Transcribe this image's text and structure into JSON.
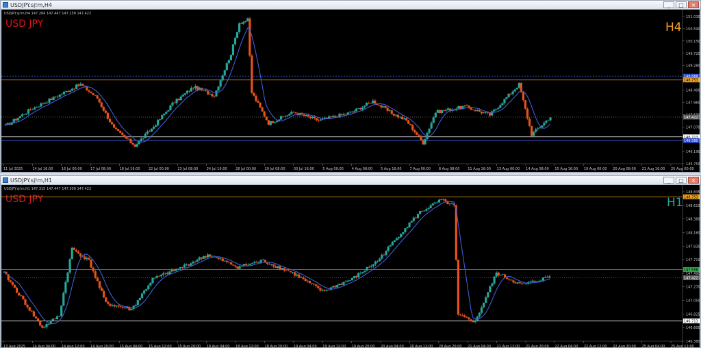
{
  "window1": {
    "title": "USDJPY.sj!m,H4",
    "info": "USDJPY.sj!m,H4  147.284 147.447 147.258 147.422",
    "symbol_label": "USD JPY",
    "timeframe_label": "H4",
    "price_axis": [
      "151.030",
      "150.590",
      "150.150",
      "149.720",
      "149.280",
      "148.840",
      "148.400",
      "147.960",
      "147.530",
      "147.070",
      "146.630",
      "146.190",
      "145.750"
    ],
    "tags": {
      "blue_top": "148.888",
      "orange": "148.753",
      "current": "147.422",
      "white": "146.713",
      "blue_bottom": "146.580"
    },
    "time_axis": [
      "11 Jul 2025",
      "14 Jul 16:00",
      "16 Jul 00:00",
      "17 Jul 08:00",
      "18 Jul 16:00",
      "22 Jul 00:00",
      "23 Jul 08:00",
      "24 Jul 16:00",
      "28 Jul 00:00",
      "29 Jul 08:00",
      "30 Jul 16:00",
      "5 Aug 00:00",
      "4 Aug 08:00",
      "5 Aug 16:00",
      "7 Aug 00:00",
      "8 Aug 08:00",
      "11 Aug 16:00",
      "13 Aug 00:00",
      "14 Aug 08:00",
      "15 Aug 16:00",
      "19 Aug 00:00",
      "20 Aug 08:00",
      "21 Aug 16:00",
      "25 Aug 00:00"
    ]
  },
  "window2": {
    "title": "USDJPY.sj!m,H1",
    "info": "USDJPY.sj!m,H1  147.315 147.447 147.309 147.422",
    "symbol_label": "USD JPY",
    "timeframe_label": "H1",
    "price_axis": [
      "148.835",
      "148.610",
      "148.380",
      "148.160",
      "147.935",
      "147.710",
      "147.490",
      "147.270",
      "147.050",
      "146.825",
      "146.600",
      "146.380"
    ],
    "tags": {
      "orange": "148.753",
      "green": "147.556",
      "current": "147.422",
      "white": "146.713"
    },
    "time_axis": [
      "13 Aug 2025",
      "14 Aug 04:00",
      "14 Aug 12:00",
      "14 Aug 20:00",
      "15 Aug 04:00",
      "15 Aug 12:00",
      "15 Aug 20:00",
      "18 Aug 04:00",
      "18 Aug 12:00",
      "18 Aug 20:00",
      "19 Aug 04:00",
      "19 Aug 12:00",
      "19 Aug 20:00",
      "20 Aug 04:00",
      "20 Aug 12:00",
      "20 Aug 20:00",
      "21 Aug 04:00",
      "21 Aug 12:00",
      "21 Aug 20:00",
      "22 Aug 04:00",
      "22 Aug 12:00",
      "22 Aug 20:00",
      "25 Aug 04:00",
      "25 Aug 12:00"
    ]
  },
  "buttons": {
    "minimize": "_",
    "maximize": "□",
    "close": "×"
  },
  "colors": {
    "bull": "#26a69a",
    "bear": "#e8521c",
    "ma": "#3e5fd9",
    "orange_line": "#f0a020",
    "green_line": "#2fa84f",
    "white_line": "#ffffff",
    "symbol": "#e0141a",
    "timeframe_h4": "#f0a020",
    "timeframe_h1": "#26a69a"
  }
}
